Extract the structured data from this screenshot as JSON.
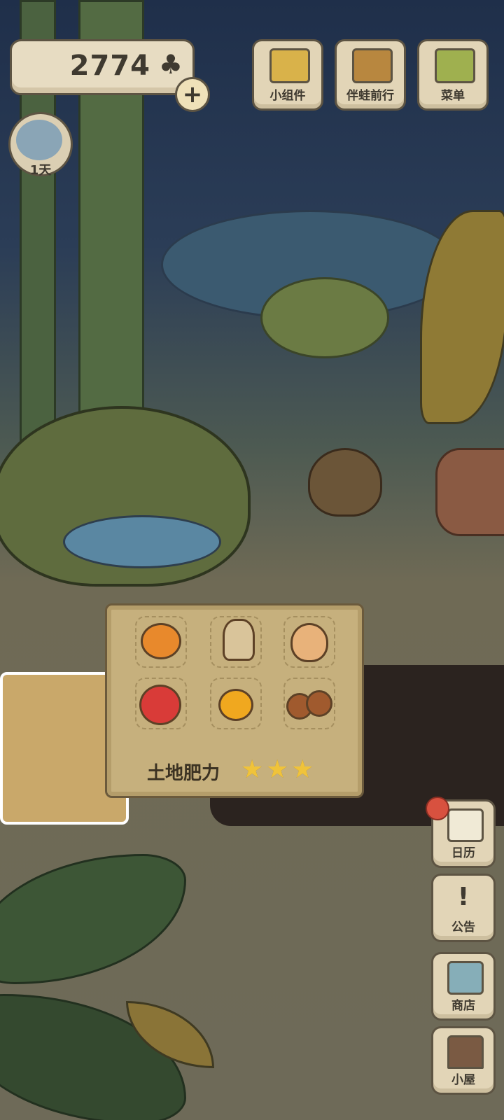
{
  "hud": {
    "clover_count": "2774",
    "clover_icon": "clover-icon",
    "add_label": "+",
    "day_label": "1天"
  },
  "top_menu": [
    {
      "label": "小组件",
      "icon": "widget-icon"
    },
    {
      "label": "伴蛙前行",
      "icon": "book-icon"
    },
    {
      "label": "菜单",
      "icon": "cards-icon"
    }
  ],
  "side_menu": [
    {
      "label": "日历",
      "icon": "calendar-icon"
    },
    {
      "label": "公告",
      "icon": "exclamation-icon"
    },
    {
      "label": "商店",
      "icon": "shop-bags-icon"
    },
    {
      "label": "小屋",
      "icon": "house-icon"
    }
  ],
  "harvest_panel": {
    "items": [
      {
        "name": "persimmon",
        "color": "#e8892c"
      },
      {
        "name": "rice-sack",
        "color": "#d9c49a"
      },
      {
        "name": "onion",
        "color": "#e8b27a"
      },
      {
        "name": "apple",
        "color": "#d93b38"
      },
      {
        "name": "mandarin",
        "color": "#f0a81f"
      },
      {
        "name": "chestnuts",
        "color": "#a05a2e"
      }
    ],
    "fertility_label": "土地肥力",
    "fertility_stars": 3,
    "star_glyph": "★"
  },
  "colors": {
    "panel": "#c6b07d",
    "badge": "#d8513f"
  }
}
